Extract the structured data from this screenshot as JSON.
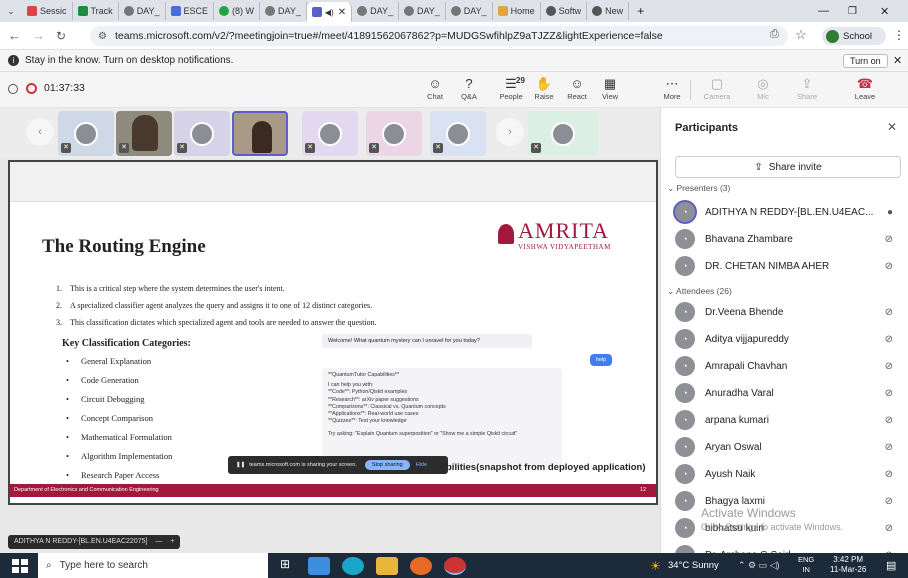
{
  "browser": {
    "tabs": [
      "Sessic",
      "Track",
      "DAY_",
      "ESCE",
      "(8) W",
      "DAY_",
      "",
      "DAY_",
      "DAY_",
      "DAY_",
      "Home",
      "Softw",
      "New"
    ],
    "new_tab": "+",
    "url": "teams.microsoft.com/v2/?meetingjoin=true#/meet/41891562067862?p=MUDGSwfihlpZ9aTJZZ&lightExperience=false",
    "profile_label": "School"
  },
  "notification": {
    "text": "Stay in the know. Turn on desktop notifications.",
    "button": "Turn on"
  },
  "meeting": {
    "timer": "01:37:33",
    "controls": [
      {
        "label": "Chat",
        "icon": "chat-icon",
        "glyph": "☺"
      },
      {
        "label": "Q&A",
        "icon": "qa-icon",
        "glyph": "?"
      },
      {
        "label": "People",
        "icon": "people-icon",
        "glyph": "☰"
      },
      {
        "label": "Raise",
        "icon": "hand-icon",
        "glyph": "✋"
      },
      {
        "label": "React",
        "icon": "react-icon",
        "glyph": "☺"
      },
      {
        "label": "View",
        "icon": "view-icon",
        "glyph": "▦"
      },
      {
        "label": "More",
        "icon": "more-icon",
        "glyph": "⋯"
      },
      {
        "label": "Camera",
        "icon": "camera-icon",
        "glyph": "▢"
      },
      {
        "label": "Mic",
        "icon": "mic-icon",
        "glyph": "◎"
      },
      {
        "label": "Share",
        "icon": "share-icon",
        "glyph": "⇪"
      },
      {
        "label": "Leave",
        "icon": "leave-icon",
        "glyph": "☎"
      }
    ],
    "people_count": "29",
    "presenter_chip": "ADITHYA N REDDY-[BL.EN.U4EAC22075]"
  },
  "slide": {
    "title": "The Routing Engine",
    "logo_text": "AMRITA",
    "logo_subtext": "VISHWA VIDYAPEETHAM",
    "points": [
      "This is a critical step where the system determines the user's intent.",
      "A specialized classifier agent analyzes the query and assigns it to one of 12 distinct categories.",
      "This classification dictates which specialized agent and tools are needed to answer the question."
    ],
    "categories_heading": "Key Classification Categories:",
    "categories": [
      "General Explanation",
      "Code Generation",
      "Circuit Debugging",
      "Concept Comparison",
      "Mathematical Formulation",
      "Algorithm Implementation",
      "Research Paper Access"
    ],
    "chat_welcome": "Welcome! What quantum mystery can I unravel for you today?",
    "chat_help": "help",
    "chat_caps_title": "**QuantumTutor Capabilities**",
    "chat_caps_lines": [
      "I can help you with:",
      "**Code**: Python/Qiskit examples",
      "**Research**: arXiv paper suggestions",
      "**Comparisons**: Classical vs. Quantum concepts",
      "**Applications**: Real-world use cases",
      "**Quizzes**: Test your knowledge",
      "Try asking: \"Explain Quantum superposition\" or \"Show me a simple Qiskit circuit\""
    ],
    "snapshot_caption": "bilities(snapshot from deployed application)",
    "sharing_text": "teams.microsoft.com is sharing your screen.",
    "stop_sharing": "Stop sharing",
    "hide": "Hide",
    "footer_left": "Department of Electronics and Communication Engineering",
    "footer_page": "12"
  },
  "participants": {
    "title": "Participants",
    "share_invite": "Share invite",
    "presenters_label": "Presenters (3)",
    "presenters": [
      {
        "name": "ADITHYA N REDDY-[BL.EN.U4EAC...",
        "state": "mic-on"
      },
      {
        "name": "Bhavana Zhambare",
        "state": "muted"
      },
      {
        "name": "DR. CHETAN NIMBA AHER",
        "state": "muted"
      }
    ],
    "attendees_label": "Attendees (26)",
    "attendees": [
      {
        "name": "Dr.Veena Bhende",
        "state": "muted"
      },
      {
        "name": "Aditya vijjapureddy",
        "state": "muted"
      },
      {
        "name": "Amrapali Chavhan",
        "state": "muted"
      },
      {
        "name": "Anuradha Varal",
        "state": "muted"
      },
      {
        "name": "arpana kumari",
        "state": "muted"
      },
      {
        "name": "Aryan Oswal",
        "state": "muted"
      },
      {
        "name": "Ayush Naik",
        "state": "muted"
      },
      {
        "name": "Bhagya laxmi",
        "state": "muted"
      },
      {
        "name": "bibhatsu kuiri",
        "state": "muted"
      },
      {
        "name": "Dr. Archana G Said",
        "state": "muted"
      }
    ],
    "watermark_title": "Activate Windows",
    "watermark_sub": "Go to Settings to activate Windows."
  },
  "taskbar": {
    "search_placeholder": "Type here to search",
    "weather": "34°C  Sunny",
    "lang": "ENG",
    "lang_region": "IN",
    "time": "3:42 PM",
    "date": "11-Mar-26"
  },
  "colors": {
    "teams_purple": "#5b5fc7",
    "leave_red": "#c4314b",
    "record_red": "#d13438",
    "amrita_maroon": "#a2193d",
    "taskbar": "#1c2a3a"
  }
}
